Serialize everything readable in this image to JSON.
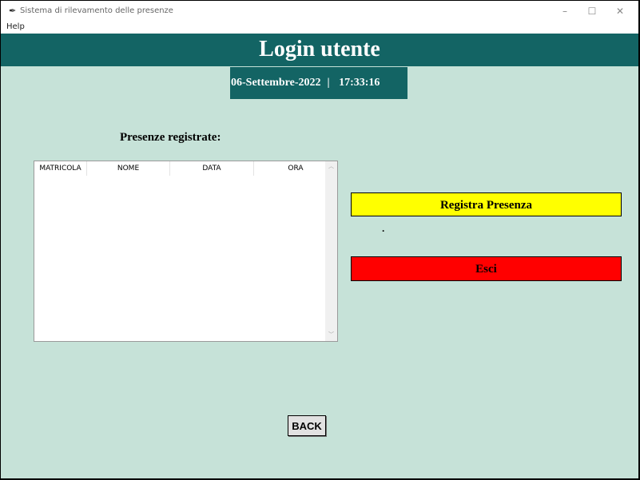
{
  "window": {
    "title": "Sistema di rilevamento delle presenze",
    "controls": {
      "minimize": "–",
      "maximize": "☐",
      "close": "✕"
    }
  },
  "menubar": {
    "help": "Help"
  },
  "header": {
    "title": "Login utente"
  },
  "datetime": {
    "date": "06-Settembre-2022",
    "separator": "|",
    "time": "17:33:16"
  },
  "attendance": {
    "label": "Presenze registrate:",
    "columns": [
      "MATRICOLA",
      "NOME",
      "DATA",
      "ORA"
    ],
    "rows": []
  },
  "actions": {
    "register_label": "Registra Presenza",
    "status_text": ".",
    "exit_label": "Esci",
    "back_label": "BACK"
  },
  "colors": {
    "background": "#c6e2d8",
    "header": "#136464",
    "register_button": "#ffff00",
    "exit_button": "#ff0000"
  }
}
